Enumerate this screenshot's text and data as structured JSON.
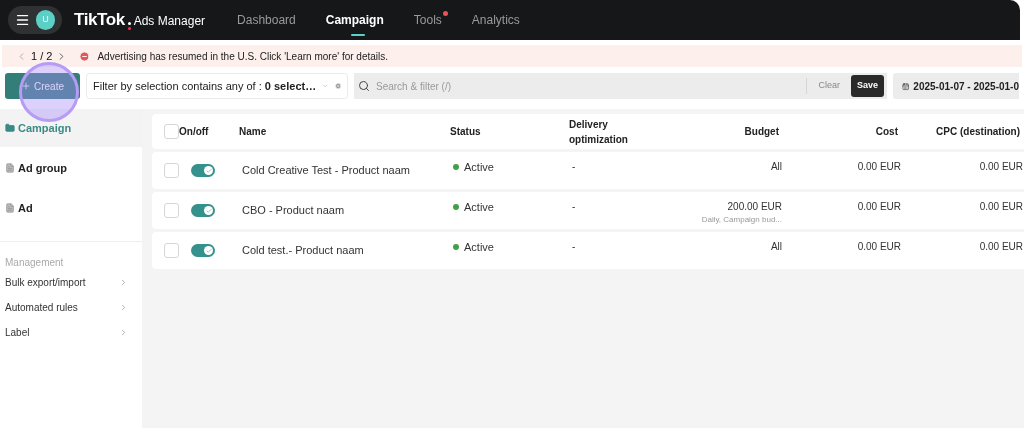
{
  "nav": {
    "avatar": "U",
    "logo": "TikTok",
    "logo_suffix": "Ads Manager",
    "tabs": [
      {
        "label": "Dashboard",
        "selected": false,
        "notification": false
      },
      {
        "label": "Campaign",
        "selected": true,
        "notification": false
      },
      {
        "label": "Tools",
        "selected": false,
        "notification": true
      },
      {
        "label": "Analytics",
        "selected": false,
        "notification": false
      }
    ]
  },
  "banner": {
    "pager": "1 / 2",
    "message": "Advertising has resumed in the U.S. Click 'Learn more' for details."
  },
  "toolbar": {
    "create": "Create",
    "filter": "Filter by selection contains any of : **0 select…**",
    "search_placeholder": "Search & filter (/)",
    "clear": "Clear",
    "save": "Save",
    "date_range": "2025-01-07 - 2025-01-0"
  },
  "sidebar": {
    "levels": [
      {
        "label": "Campaign",
        "selected": true
      },
      {
        "label": "Ad group",
        "selected": false
      },
      {
        "label": "Ad",
        "selected": false
      }
    ],
    "section": "Management",
    "links": [
      "Bulk export/import",
      "Automated rules",
      "Label"
    ]
  },
  "table": {
    "header_checked": false,
    "columns": [
      {
        "label": "On/off",
        "kind": "text"
      },
      {
        "label": "Name",
        "kind": "text"
      },
      {
        "label": "Status",
        "kind": "text"
      },
      {
        "label": "Delivery optimization",
        "kind": "text"
      },
      {
        "label": "Budget",
        "kind": "number"
      },
      {
        "label": "Cost",
        "kind": "number"
      },
      {
        "label": "CPC (destination)",
        "kind": "number"
      }
    ],
    "rows": [
      {
        "checked": false,
        "on": true,
        "name": "Cold Creative Test - Product naam",
        "status": "Active",
        "delivery": "-",
        "budget": "All",
        "cost": "0.00 EUR",
        "cpc": "0.00 EUR"
      },
      {
        "checked": false,
        "on": true,
        "name": "CBO - Product naam",
        "status": "Active",
        "delivery": "-",
        "budget": "200.00 EUR",
        "budget_note": "Daily, Campaign bud...",
        "cost": "0.00 EUR",
        "cpc": "0.00 EUR"
      },
      {
        "checked": false,
        "on": true,
        "name": "Cold test.- Product naam",
        "status": "Active",
        "delivery": "-",
        "budget": "All",
        "cost": "0.00 EUR",
        "cpc": "0.00 EUR"
      }
    ]
  }
}
